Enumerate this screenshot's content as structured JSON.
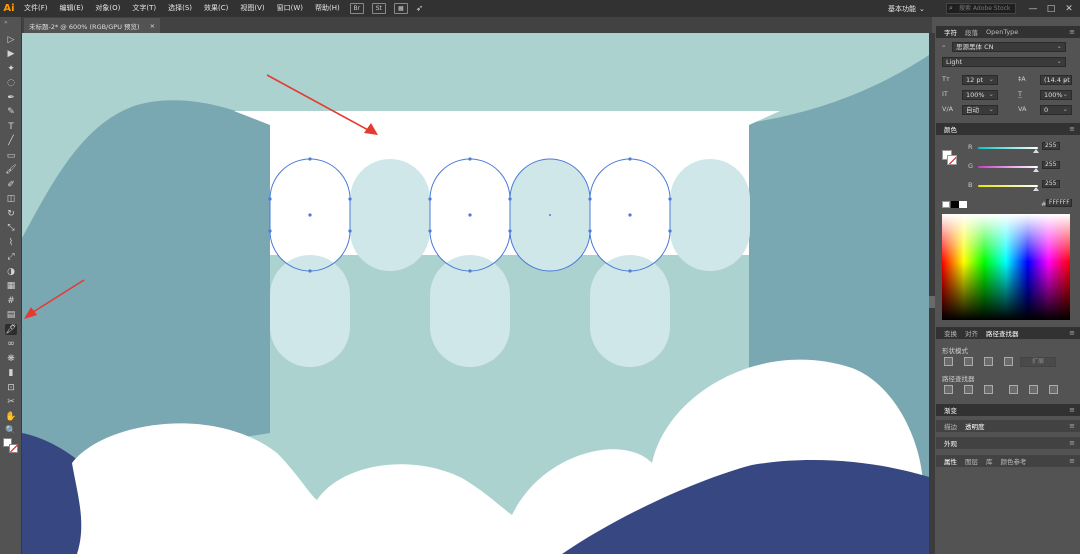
{
  "app": {
    "logo": "Ai"
  },
  "menu": [
    "文件(F)",
    "编辑(E)",
    "对象(O)",
    "文字(T)",
    "选择(S)",
    "效果(C)",
    "视图(V)",
    "窗口(W)",
    "帮助(H)"
  ],
  "menubar_icons": [
    "Br",
    "St"
  ],
  "workspace": {
    "label": "基本功能",
    "search_placeholder": "搜索 Adobe Stock"
  },
  "document_tab": {
    "title": "未标题-2* @ 600% (RGB/GPU 预览)",
    "close": "×"
  },
  "window_controls": [
    "—",
    "□",
    "✕"
  ],
  "tools": [
    "selection-tool",
    "direct-selection-tool",
    "magic-wand-tool",
    "lasso-tool",
    "pen-tool",
    "curvature-tool",
    "type-tool",
    "line-tool",
    "rectangle-tool",
    "paintbrush-tool",
    "shaper-tool",
    "eraser-tool",
    "rotate-tool",
    "scale-tool",
    "width-tool",
    "free-transform-tool",
    "shape-builder-tool",
    "perspective-grid-tool",
    "mesh-tool",
    "gradient-tool",
    "eyedropper-tool",
    "blend-tool",
    "symbol-sprayer-tool",
    "column-graph-tool",
    "artboard-tool",
    "slice-tool",
    "hand-tool",
    "zoom-tool"
  ],
  "tool_glyphs": [
    "▷",
    "▶",
    "✦",
    "◌",
    "✒",
    "✎",
    "T",
    "╱",
    "▭",
    "🖌",
    "✐",
    "◫",
    "↻",
    "⤡",
    "⌇",
    "⤢",
    "◑",
    "▦",
    "#",
    "▤",
    "🖋",
    "∞",
    "❋",
    "▮",
    "⊡",
    "✂",
    "✋",
    "🔍"
  ],
  "character_panel": {
    "tabs": [
      "字符",
      "段落",
      "OpenType"
    ],
    "font_family": "思源黑体 CN",
    "font_style": "Light",
    "font_size": "12 pt",
    "leading": "(14.4 pt",
    "vertical_scale": "100%",
    "horizontal_scale": "100%",
    "kerning": "自动",
    "tracking": "0"
  },
  "color_panel": {
    "title": "颜色",
    "channels": [
      {
        "label": "R",
        "value": "255",
        "color": "#00c8c8"
      },
      {
        "label": "G",
        "value": "255",
        "color": "#c83cc8"
      },
      {
        "label": "B",
        "value": "255",
        "color": "#e6e600"
      }
    ],
    "hex_prefix": "#",
    "hex": "FFFFFF"
  },
  "pathfinder_panel": {
    "tabs": [
      "变换",
      "对齐",
      "路径查找器"
    ],
    "shape_modes_label": "形状模式",
    "expand_label": "扩展",
    "pathfinders_label": "路径查找器"
  },
  "gradient_panel": {
    "title": "渐变"
  },
  "stroke_transparency_tabs": [
    "描边",
    "透明度"
  ],
  "appearance_panel": {
    "title": "外观"
  },
  "bottom_tabs": [
    "属性",
    "图层",
    "库",
    "颜色参考"
  ],
  "colors": {
    "sky": "#abd2cf",
    "hill_blue": "#7aa8b2",
    "navy": "#364781",
    "white": "#ffffff",
    "pale_teal": "#cfe7e8",
    "selection": "#4b7bd8",
    "arrow": "#e23c32"
  }
}
